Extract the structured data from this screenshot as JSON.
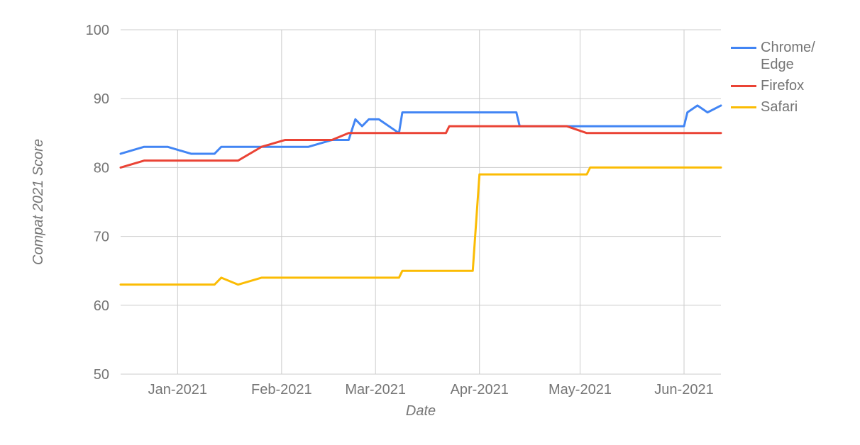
{
  "chart_data": {
    "type": "line",
    "xlabel": "Date",
    "ylabel": "Compat 2021 Score",
    "ylim": [
      50,
      100
    ],
    "yticks": [
      50,
      60,
      70,
      80,
      90,
      100
    ],
    "xticks": [
      "Jan-2021",
      "Feb-2021",
      "Mar-2021",
      "Apr-2021",
      "May-2021",
      "Jun-2021"
    ],
    "x": [
      "2020-12-15",
      "2020-12-22",
      "2020-12-29",
      "2021-01-05",
      "2021-01-12",
      "2021-01-14",
      "2021-01-19",
      "2021-01-26",
      "2021-02-02",
      "2021-02-09",
      "2021-02-16",
      "2021-02-21",
      "2021-02-23",
      "2021-02-25",
      "2021-02-27",
      "2021-03-02",
      "2021-03-08",
      "2021-03-09",
      "2021-03-16",
      "2021-03-22",
      "2021-03-23",
      "2021-03-30",
      "2021-04-01",
      "2021-04-06",
      "2021-04-12",
      "2021-04-13",
      "2021-04-20",
      "2021-04-27",
      "2021-05-03",
      "2021-05-04",
      "2021-05-11",
      "2021-05-18",
      "2021-05-25",
      "2021-06-01",
      "2021-06-02",
      "2021-06-05",
      "2021-06-08",
      "2021-06-12"
    ],
    "series": [
      {
        "name": "Chrome/Edge",
        "color": "#4285f4",
        "values": [
          82,
          83,
          83,
          82,
          82,
          83,
          83,
          83,
          83,
          83,
          84,
          84,
          87,
          86,
          87,
          87,
          85,
          88,
          88,
          88,
          88,
          88,
          88,
          88,
          88,
          86,
          86,
          86,
          86,
          86,
          86,
          86,
          86,
          86,
          88,
          89,
          88,
          89
        ]
      },
      {
        "name": "Firefox",
        "color": "#ea4335",
        "values": [
          80,
          81,
          81,
          81,
          81,
          81,
          81,
          83,
          84,
          84,
          84,
          85,
          85,
          85,
          85,
          85,
          85,
          85,
          85,
          85,
          86,
          86,
          86,
          86,
          86,
          86,
          86,
          86,
          85,
          85,
          85,
          85,
          85,
          85,
          85,
          85,
          85,
          85
        ]
      },
      {
        "name": "Safari",
        "color": "#fbbc04",
        "values": [
          63,
          63,
          63,
          63,
          63,
          64,
          63,
          64,
          64,
          64,
          64,
          64,
          64,
          64,
          64,
          64,
          64,
          65,
          65,
          65,
          65,
          65,
          79,
          79,
          79,
          79,
          79,
          79,
          79,
          80,
          80,
          80,
          80,
          80,
          80,
          80,
          80,
          80
        ]
      }
    ]
  },
  "legend": {
    "items": [
      {
        "label": "Chrome/\nEdge",
        "color": "#4285f4"
      },
      {
        "label": "Firefox",
        "color": "#ea4335"
      },
      {
        "label": "Safari",
        "color": "#fbbc04"
      }
    ]
  }
}
